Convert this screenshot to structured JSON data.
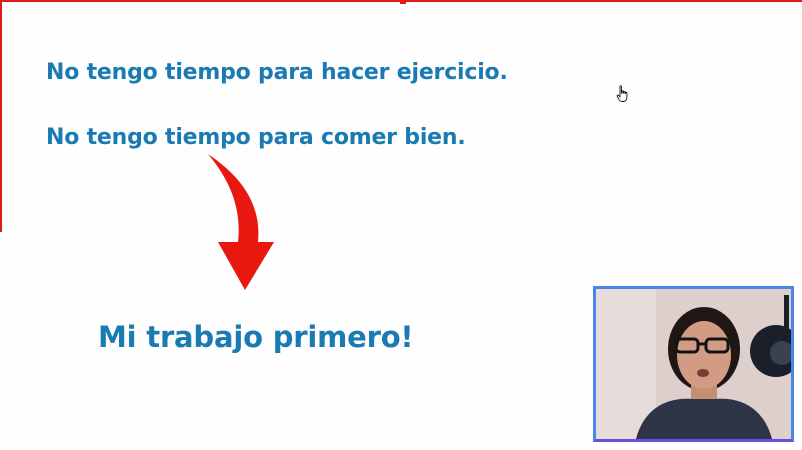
{
  "slide": {
    "line_1": "No tengo tiempo para hacer ejercicio.",
    "line_2": "No tengo tiempo para comer bien.",
    "conclusion": "Mi trabajo primero!"
  },
  "colors": {
    "text": "#1a7ab3",
    "arrow": "#e8170f",
    "frame": "#e01b1b",
    "webcam_border": "#4a86e8"
  },
  "icons": {
    "arrow": "curved-down-arrow-icon",
    "cursor": "hand-pointer-icon"
  }
}
